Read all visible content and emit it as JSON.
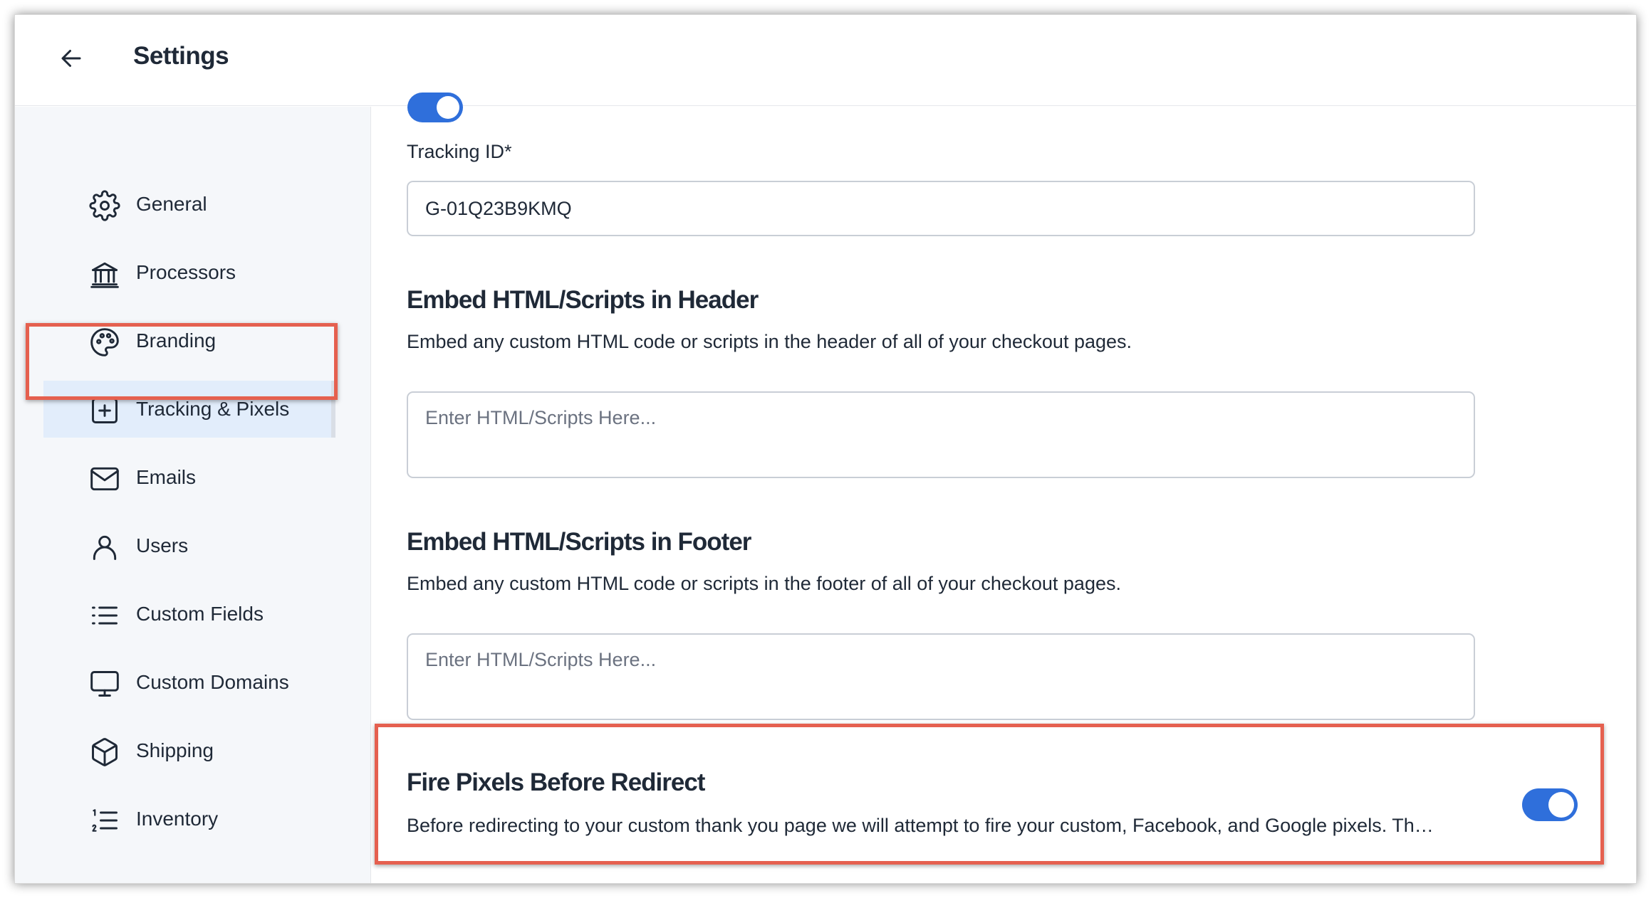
{
  "header": {
    "title": "Settings",
    "back_icon": "arrow-left-icon"
  },
  "sidebar": {
    "items": [
      {
        "label": "General",
        "icon": "gear-icon",
        "active": false
      },
      {
        "label": "Processors",
        "icon": "bank-icon",
        "active": false
      },
      {
        "label": "Branding",
        "icon": "palette-icon",
        "active": false
      },
      {
        "label": "Tracking & Pixels",
        "icon": "plus-square-icon",
        "active": true
      },
      {
        "label": "Emails",
        "icon": "mail-icon",
        "active": false
      },
      {
        "label": "Users",
        "icon": "user-icon",
        "active": false
      },
      {
        "label": "Custom Fields",
        "icon": "list-icon",
        "active": false
      },
      {
        "label": "Custom Domains",
        "icon": "monitor-icon",
        "active": false
      },
      {
        "label": "Shipping",
        "icon": "box-icon",
        "active": false
      },
      {
        "label": "Inventory",
        "icon": "numbered-list-icon",
        "active": false
      }
    ]
  },
  "main": {
    "tracking_id": {
      "label": "Tracking ID*",
      "value": "G-01Q23B9KMQ"
    },
    "embed_header": {
      "title": "Embed HTML/Scripts in Header",
      "description": "Embed any custom HTML code or scripts in the header of all of your checkout pages.",
      "placeholder": "Enter HTML/Scripts Here..."
    },
    "embed_footer": {
      "title": "Embed HTML/Scripts in Footer",
      "description": "Embed any custom HTML code or scripts in the footer of all of your checkout pages.",
      "placeholder": "Enter HTML/Scripts Here..."
    },
    "fire_pixels": {
      "title": "Fire Pixels Before Redirect",
      "description": "Before redirecting to your custom thank you page we will attempt to fire your custom, Facebook, and Google pixels. Th…",
      "enabled": true
    }
  },
  "colors": {
    "accent": "#2f6fdb",
    "highlight": "#e5604f",
    "active_nav_bg": "#e2edfb",
    "sidebar_bg": "#f5f7fa"
  }
}
